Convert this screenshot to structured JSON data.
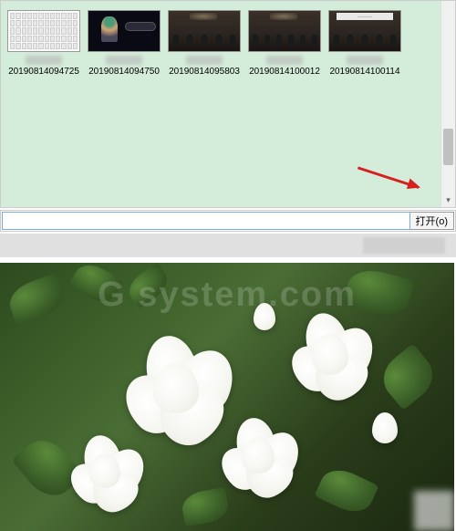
{
  "thumbnails": [
    {
      "label": "20190814094725",
      "type": "keyboard"
    },
    {
      "label": "20190814094750",
      "type": "anime"
    },
    {
      "label": "20190814095803",
      "type": "scene"
    },
    {
      "label": "20190814100012",
      "type": "scene"
    },
    {
      "label": "20190814100114",
      "type": "scene-banner"
    }
  ],
  "open_button": "打开(o)",
  "watermark_text": "G system.com"
}
